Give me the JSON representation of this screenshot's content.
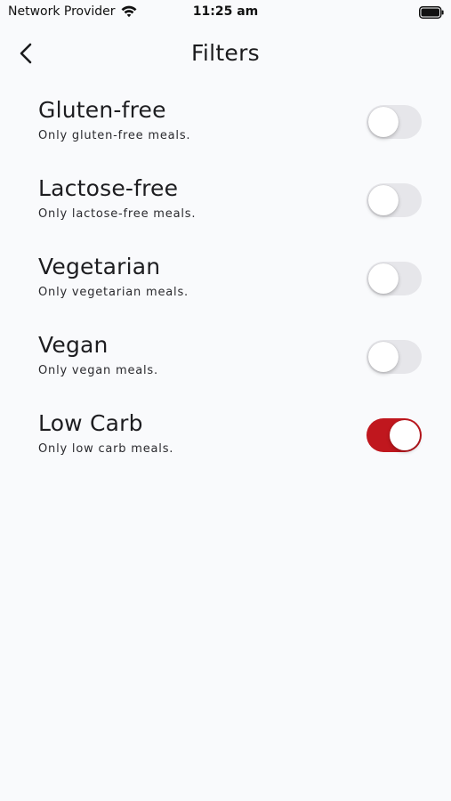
{
  "status_bar": {
    "carrier": "Network Provider",
    "time": "11:25 am",
    "wifi_icon": "wifi-icon",
    "battery_icon": "battery-icon"
  },
  "header": {
    "title": "Filters",
    "back_icon": "chevron-left-icon"
  },
  "filters": [
    {
      "title": "Gluten-free",
      "subtitle": "Only gluten-free meals.",
      "enabled": false
    },
    {
      "title": "Lactose-free",
      "subtitle": "Only lactose-free meals.",
      "enabled": false
    },
    {
      "title": "Vegetarian",
      "subtitle": "Only vegetarian meals.",
      "enabled": false
    },
    {
      "title": "Vegan",
      "subtitle": "Only vegan meals.",
      "enabled": false
    },
    {
      "title": "Low Carb",
      "subtitle": "Only low carb meals.",
      "enabled": true
    }
  ],
  "colors": {
    "background": "#f9fafc",
    "switch_on": "#c0171e",
    "switch_off": "#e6e6ea"
  }
}
